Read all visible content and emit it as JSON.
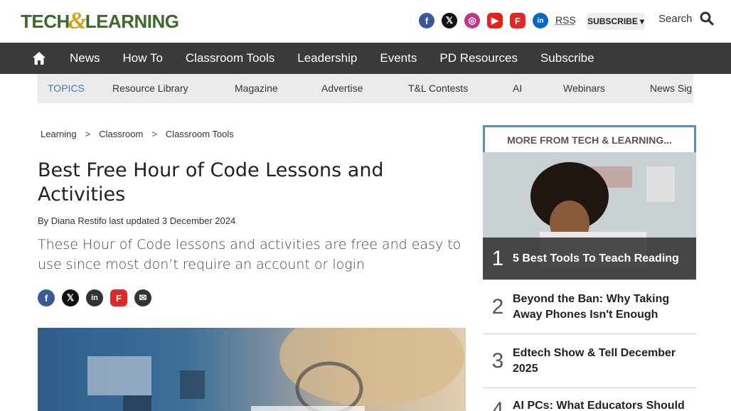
{
  "header": {
    "logo_text_left": "TECH",
    "logo_amp": "&",
    "logo_text_right": "LEARNING",
    "socials": [
      {
        "name": "facebook",
        "glyph": "f"
      },
      {
        "name": "x",
        "glyph": "𝕏"
      },
      {
        "name": "instagram",
        "glyph": "◎"
      },
      {
        "name": "youtube",
        "glyph": "▶"
      },
      {
        "name": "flipboard",
        "glyph": "F"
      },
      {
        "name": "linkedin",
        "glyph": "in"
      }
    ],
    "rss_label": "RSS",
    "subscribe_label": "SUBSCRIBE",
    "search_label": "Search"
  },
  "nav": {
    "items": [
      "News",
      "How To",
      "Classroom Tools",
      "Leadership",
      "Events",
      "PD Resources",
      "Subscribe"
    ]
  },
  "topics": {
    "lead": "TOPICS",
    "items": [
      "Resource Library",
      "Magazine",
      "Advertise",
      "T&L Contests",
      "AI",
      "Webinars",
      "News Sig"
    ]
  },
  "breadcrumb": [
    "Learning",
    "Classroom",
    "Classroom Tools"
  ],
  "breadcrumb_sep": ">",
  "article": {
    "title": "Best Free Hour of Code Lessons and Activities",
    "byline": "By Diana Restifo last updated 3 December 2024",
    "summary": "These Hour of Code lessons and activities are free and easy to use since most don’t require an account or login"
  },
  "share": [
    {
      "name": "facebook",
      "glyph": "f",
      "color": "#3b5998"
    },
    {
      "name": "x",
      "glyph": "𝕏",
      "color": "#111111"
    },
    {
      "name": "linkedin",
      "glyph": "in",
      "color": "#0a66c2"
    },
    {
      "name": "flipboard",
      "glyph": "F",
      "color": "#e12828"
    },
    {
      "name": "email",
      "glyph": "✉",
      "color": "#333333"
    }
  ],
  "sidebar": {
    "heading": "MORE FROM TECH & LEARNING...",
    "items": [
      {
        "rank": "1",
        "title": "5 Best Tools To Teach Reading"
      },
      {
        "rank": "2",
        "title": "Beyond the Ban: Why Taking Away Phones Isn't Enough"
      },
      {
        "rank": "3",
        "title": "Edtech Show & Tell December 2025"
      },
      {
        "rank": "4",
        "title": "AI PCs: What Educators Should"
      }
    ]
  }
}
